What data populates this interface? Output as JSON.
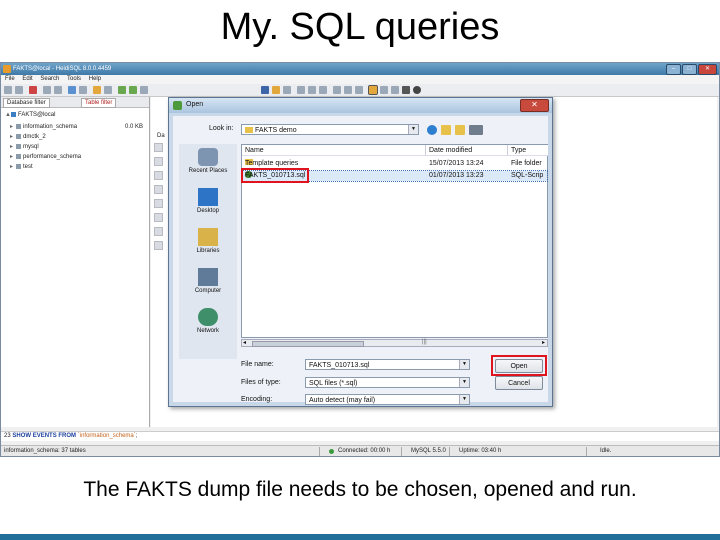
{
  "slide": {
    "title": "My. SQL queries",
    "caption": "The FAKTS dump file needs to be chosen, opened and run."
  },
  "app": {
    "window_title": "FAKTS@local - HeidiSQL 8.0.0.4459",
    "menu": [
      "File",
      "Edit",
      "Search",
      "Tools",
      "Help"
    ],
    "filter_tabs": [
      "Database filter",
      "Table filter"
    ],
    "tree": [
      {
        "label": "FAKTS@local",
        "size": ""
      },
      {
        "label": "information_schema",
        "size": "0.0 KB"
      },
      {
        "label": "dmctk_2",
        "size": ""
      },
      {
        "label": "mysql",
        "size": ""
      },
      {
        "label": "performance_schema",
        "size": ""
      },
      {
        "label": "test",
        "size": ""
      }
    ],
    "query_line": {
      "num": "23",
      "kw1": "SHOW",
      "kw2": "EVENTS",
      "kw3": "FROM",
      "db": "`information_schema`",
      "end": ";"
    },
    "status": {
      "left": "information_schema: 37 tables",
      "connected": "Connected: 00:00 h",
      "server": "MySQL 5.5.0",
      "uptime": "Uptime: 03:40 h",
      "state": "Idle."
    },
    "editor_tab": "Da"
  },
  "dialog": {
    "title": "Open",
    "look_in_label": "Look in:",
    "look_in_value": "FAKTS demo",
    "places": [
      "Recent Places",
      "Desktop",
      "Libraries",
      "Computer",
      "Network"
    ],
    "columns": [
      "Name",
      "Date modified",
      "Type"
    ],
    "files": [
      {
        "name": "Template queries",
        "date": "15/07/2013 13:24",
        "type": "File folder",
        "kind": "folder",
        "selected": false
      },
      {
        "name": "FAKTS_010713.sql",
        "date": "01/07/2013 13:23",
        "type": "SQL-Scrip",
        "kind": "sql",
        "selected": true
      }
    ],
    "file_name_label": "File name:",
    "file_name_value": "FAKTS_010713.sql",
    "files_of_type_label": "Files of type:",
    "files_of_type_value": "SQL files (*.sql)",
    "encoding_label": "Encoding:",
    "encoding_value": "Auto detect (may fail)",
    "open_button": "Open",
    "cancel_button": "Cancel",
    "close_glyph": "✕"
  },
  "colors": {
    "highlight": "#e0141e",
    "slide_rule": "#1f6f9a"
  }
}
